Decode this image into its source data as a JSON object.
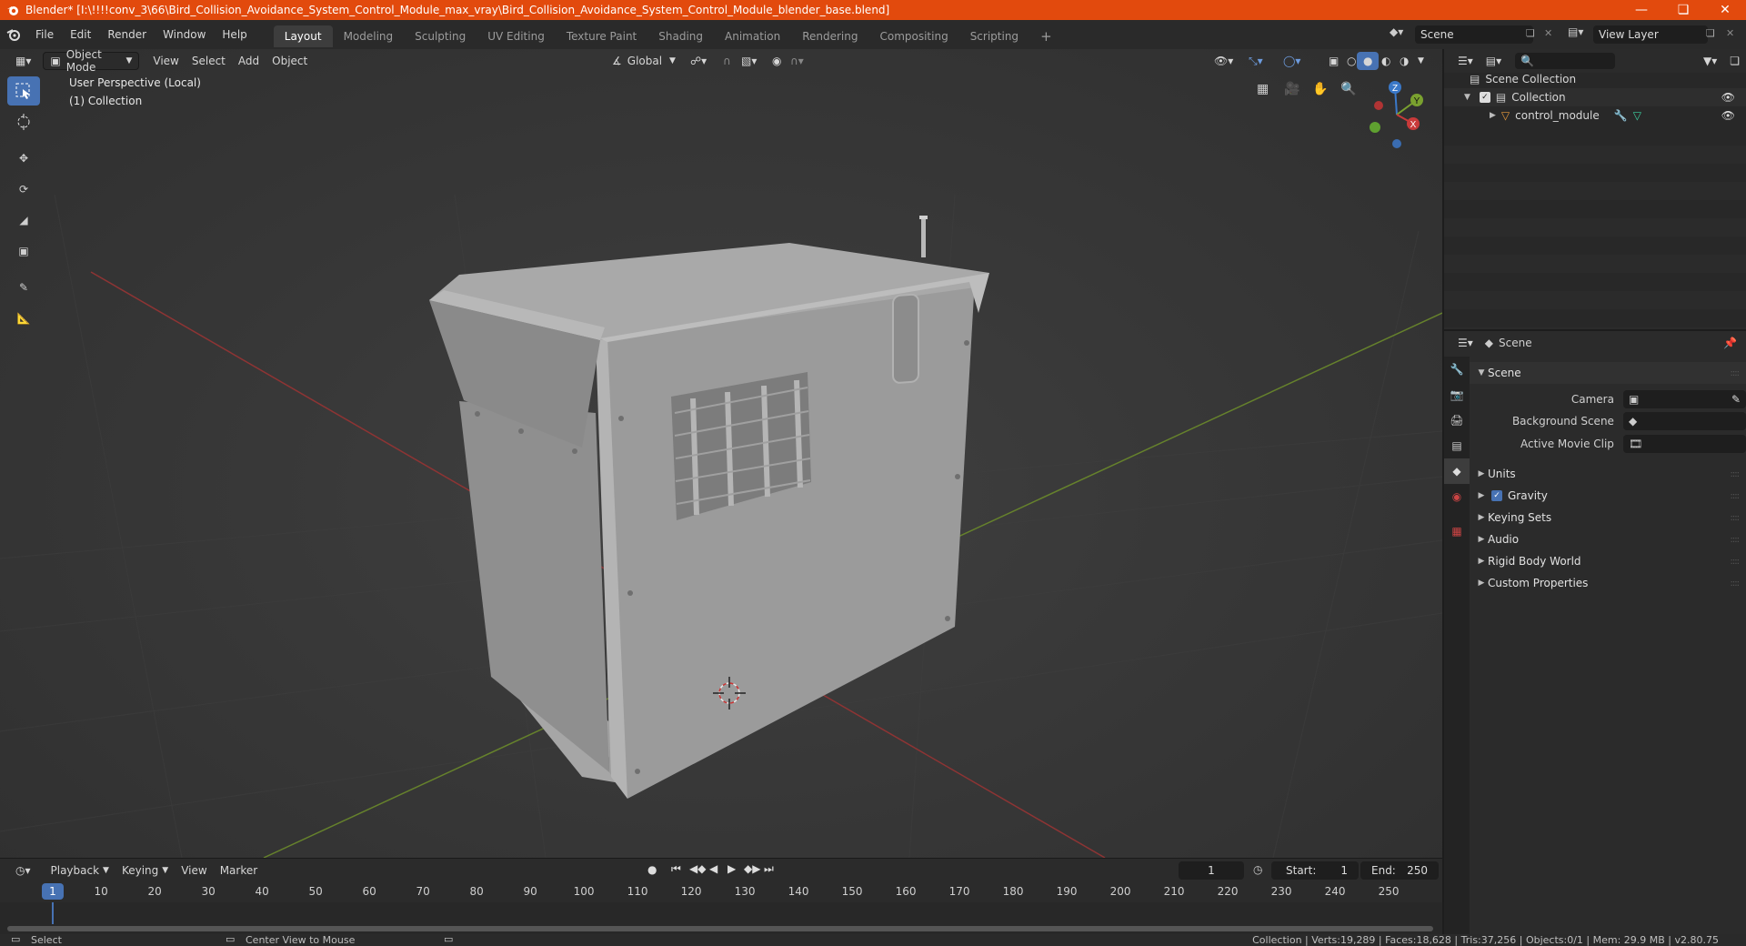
{
  "window": {
    "title": "Blender* [I:\\!!!!conv_3\\66\\Bird_Collision_Avoidance_System_Control_Module_max_vray\\Bird_Collision_Avoidance_System_Control_Module_blender_base.blend]"
  },
  "menu": [
    "File",
    "Edit",
    "Render",
    "Window",
    "Help"
  ],
  "workspaces": [
    "Layout",
    "Modeling",
    "Sculpting",
    "UV Editing",
    "Texture Paint",
    "Shading",
    "Animation",
    "Rendering",
    "Compositing",
    "Scripting"
  ],
  "active_workspace": "Layout",
  "top_right": {
    "scene": "Scene",
    "view_layer": "View Layer"
  },
  "viewport": {
    "mode": "Object Mode",
    "menus": [
      "View",
      "Select",
      "Add",
      "Object"
    ],
    "transform_orientation": "Global",
    "info_line1": "User Perspective (Local)",
    "info_line2": "(1) Collection",
    "gizmo": {
      "z": "Z",
      "y": "Y",
      "x": "X"
    }
  },
  "outliner": {
    "root": "Scene Collection",
    "collection": "Collection",
    "object": "control_module"
  },
  "properties": {
    "header": "Scene",
    "panel": "Scene",
    "camera_label": "Camera",
    "bg_scene_label": "Background Scene",
    "movie_clip_label": "Active Movie Clip",
    "sections": [
      "Units",
      "Gravity",
      "Keying Sets",
      "Audio",
      "Rigid Body World",
      "Custom Properties"
    ]
  },
  "timeline": {
    "menus": [
      "Playback",
      "Keying",
      "View",
      "Marker"
    ],
    "current_frame": "1",
    "start_label": "Start:",
    "start": "1",
    "end_label": "End:",
    "end": "250",
    "ticks": [
      "1",
      "10",
      "20",
      "30",
      "40",
      "50",
      "60",
      "70",
      "80",
      "90",
      "100",
      "110",
      "120",
      "130",
      "140",
      "150",
      "160",
      "170",
      "180",
      "190",
      "200",
      "210",
      "220",
      "230",
      "240",
      "250"
    ]
  },
  "status": {
    "left1": "Select",
    "left2": "Center View to Mouse",
    "right": "Collection | Verts:19,289 | Faces:18,628 | Tris:37,256 | Objects:0/1 | Mem: 29.9 MB | v2.80.75"
  },
  "colors": {
    "titlebar": "#e24a0d",
    "accent": "#4772b3",
    "x_axis": "#c83a3a",
    "y_axis": "#7aa12f",
    "z_axis": "#3a78c8"
  }
}
